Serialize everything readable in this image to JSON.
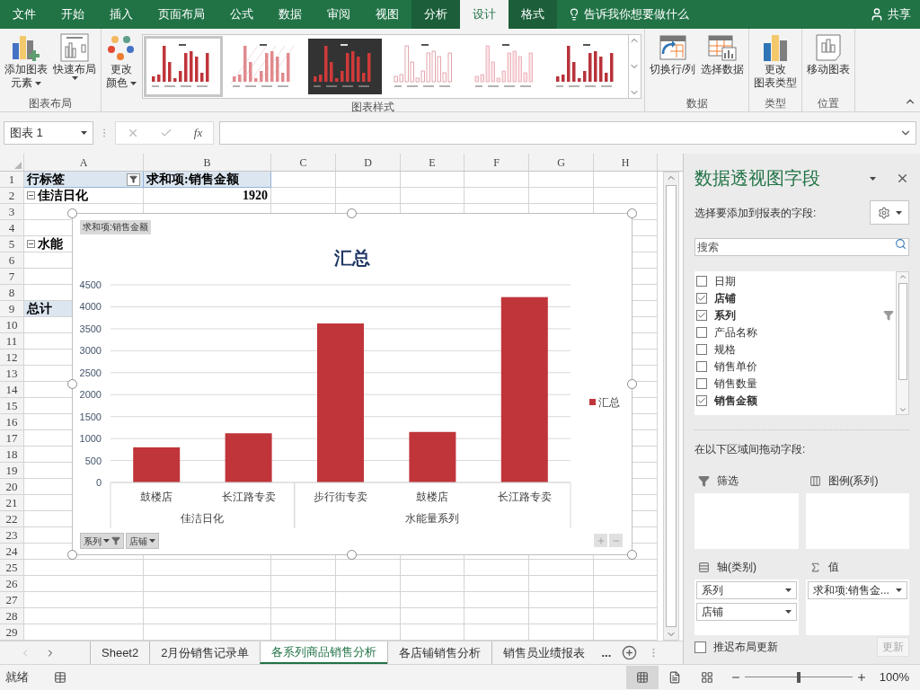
{
  "ribbon_tabs": [
    {
      "label": "文件",
      "selected": false,
      "contextual": false
    },
    {
      "label": "开始",
      "selected": false,
      "contextual": false
    },
    {
      "label": "插入",
      "selected": false,
      "contextual": false
    },
    {
      "label": "页面布局",
      "selected": false,
      "contextual": false
    },
    {
      "label": "公式",
      "selected": false,
      "contextual": false
    },
    {
      "label": "数据",
      "selected": false,
      "contextual": false
    },
    {
      "label": "审阅",
      "selected": false,
      "contextual": false
    },
    {
      "label": "视图",
      "selected": false,
      "contextual": false
    },
    {
      "label": "分析",
      "selected": false,
      "contextual": true
    },
    {
      "label": "设计",
      "selected": true,
      "contextual": true
    },
    {
      "label": "格式",
      "selected": false,
      "contextual": true
    }
  ],
  "tell_me": "告诉我你想要做什么",
  "share": "共享",
  "ribbon_groups": [
    {
      "label": "图表布局",
      "buttons": [
        {
          "lines": [
            "添加图表",
            "元素"
          ],
          "dropdown": true
        },
        {
          "lines": [
            "快速布局"
          ],
          "dropdown": true
        }
      ]
    },
    {
      "label": "图表样式",
      "buttons": [
        {
          "lines": [
            "更改",
            "颜色"
          ],
          "dropdown": true
        }
      ],
      "gallery": [
        {
          "kind": "white",
          "selected": true
        },
        {
          "kind": "hatched",
          "selected": false
        },
        {
          "kind": "dark",
          "selected": false
        },
        {
          "kind": "pale",
          "selected": false
        },
        {
          "kind": "outline",
          "selected": false
        },
        {
          "kind": "plain",
          "selected": false
        }
      ]
    },
    {
      "label": "数据",
      "buttons": [
        {
          "lines": [
            "切换行/列"
          ],
          "dropdown": false
        },
        {
          "lines": [
            "选择数据"
          ],
          "dropdown": false
        }
      ]
    },
    {
      "label": "类型",
      "buttons": [
        {
          "lines": [
            "更改",
            "图表类型"
          ],
          "dropdown": false
        }
      ]
    },
    {
      "label": "位置",
      "buttons": [
        {
          "lines": [
            "移动图表"
          ],
          "dropdown": false
        }
      ]
    }
  ],
  "formula_bar": {
    "name_box": "图表 1",
    "fx": "fx"
  },
  "columns": [
    "A",
    "B",
    "C",
    "D",
    "E",
    "F",
    "G",
    "H"
  ],
  "rows": [
    {
      "label": "1",
      "kind": "header",
      "cells": [
        {
          "text": "行标签",
          "filter": true
        },
        {
          "text": "求和项:销售金额"
        }
      ]
    },
    {
      "label": "2",
      "kind": "group",
      "cells": [
        {
          "text": "佳洁日化",
          "expanded": true
        },
        {
          "text": "1920",
          "kind": "number"
        }
      ]
    },
    {
      "label": "3"
    },
    {
      "label": "4"
    },
    {
      "label": "5",
      "kind": "group",
      "cells": [
        {
          "text": "水能",
          "expanded": true
        }
      ]
    },
    {
      "label": "6"
    },
    {
      "label": "7"
    },
    {
      "label": "8"
    },
    {
      "label": "9",
      "kind": "total",
      "cells": [
        {
          "text": "总计"
        }
      ]
    },
    {
      "label": "10"
    },
    {
      "label": "11"
    },
    {
      "label": "12"
    },
    {
      "label": "13"
    },
    {
      "label": "14"
    },
    {
      "label": "15"
    },
    {
      "label": "16"
    },
    {
      "label": "17"
    },
    {
      "label": "18"
    },
    {
      "label": "19"
    },
    {
      "label": "20"
    },
    {
      "label": "21"
    },
    {
      "label": "22"
    },
    {
      "label": "23"
    },
    {
      "label": "24"
    },
    {
      "label": "25"
    },
    {
      "label": "26"
    },
    {
      "label": "27"
    },
    {
      "label": "28"
    },
    {
      "label": "29"
    }
  ],
  "chart": {
    "field_button": "求和项:销售金额",
    "chart_data": {
      "type": "bar",
      "title": "汇总",
      "grid": true,
      "series": [
        {
          "name": "汇总",
          "color": "#c0353a",
          "values": [
            800,
            1120,
            3620,
            1150,
            4220
          ]
        }
      ],
      "ylim": [
        0,
        4500
      ],
      "yticks": [
        0,
        500,
        1000,
        1500,
        2000,
        2500,
        3000,
        3500,
        4000,
        4500
      ]
    },
    "category_groups": [
      {
        "label": "佳洁日化",
        "categories": [
          "鼓楼店",
          "长江路专卖"
        ]
      },
      {
        "label": "水能量系列",
        "categories": [
          "步行街专卖",
          "鼓楼店",
          "长江路专卖"
        ]
      }
    ],
    "field_buttons": [
      {
        "label": "系列",
        "filtered": true
      },
      {
        "label": "店铺",
        "filtered": false
      }
    ]
  },
  "pane": {
    "title": "数据透视图字段",
    "subtitle": "选择要添加到报表的字段:",
    "search_placeholder": "搜索",
    "fields": [
      {
        "label": "日期",
        "checked": false,
        "filtered": false
      },
      {
        "label": "店铺",
        "checked": true,
        "filtered": false
      },
      {
        "label": "系列",
        "checked": true,
        "filtered": true
      },
      {
        "label": "产品名称",
        "checked": false,
        "filtered": false
      },
      {
        "label": "规格",
        "checked": false,
        "filtered": false
      },
      {
        "label": "销售单价",
        "checked": false,
        "filtered": false
      },
      {
        "label": "销售数量",
        "checked": false,
        "filtered": false
      },
      {
        "label": "销售金额",
        "checked": true,
        "filtered": false
      }
    ],
    "drag_hint": "在以下区域间拖动字段:",
    "areas": [
      {
        "kind": "filters",
        "label": "筛选"
      },
      {
        "kind": "legend",
        "label": "图例(系列)"
      },
      {
        "kind": "axis",
        "label": "轴(类别)",
        "items": [
          "系列",
          "店铺"
        ]
      },
      {
        "kind": "values",
        "label": "值",
        "items": [
          "求和项:销售金..."
        ]
      }
    ],
    "defer": {
      "label": "推迟布局更新",
      "checked": false
    },
    "update_button": {
      "label": "更新",
      "disabled": true
    }
  },
  "sheet_tabs": [
    {
      "label": "Sheet2",
      "selected": false
    },
    {
      "label": "2月份销售记录单",
      "selected": false
    },
    {
      "label": "各系列商品销售分析",
      "selected": true
    },
    {
      "label": "各店铺销售分析",
      "selected": false
    },
    {
      "label": "销售员业绩报表",
      "selected": false
    }
  ],
  "more_tabs": "...",
  "status": {
    "text": "就绪",
    "zoom": "100%",
    "zoom_slider": {
      "level": 0.5
    },
    "views": [
      {
        "kind": "normal",
        "selected": true
      },
      {
        "kind": "page_layout",
        "selected": false
      },
      {
        "kind": "page_break",
        "selected": false
      }
    ]
  }
}
